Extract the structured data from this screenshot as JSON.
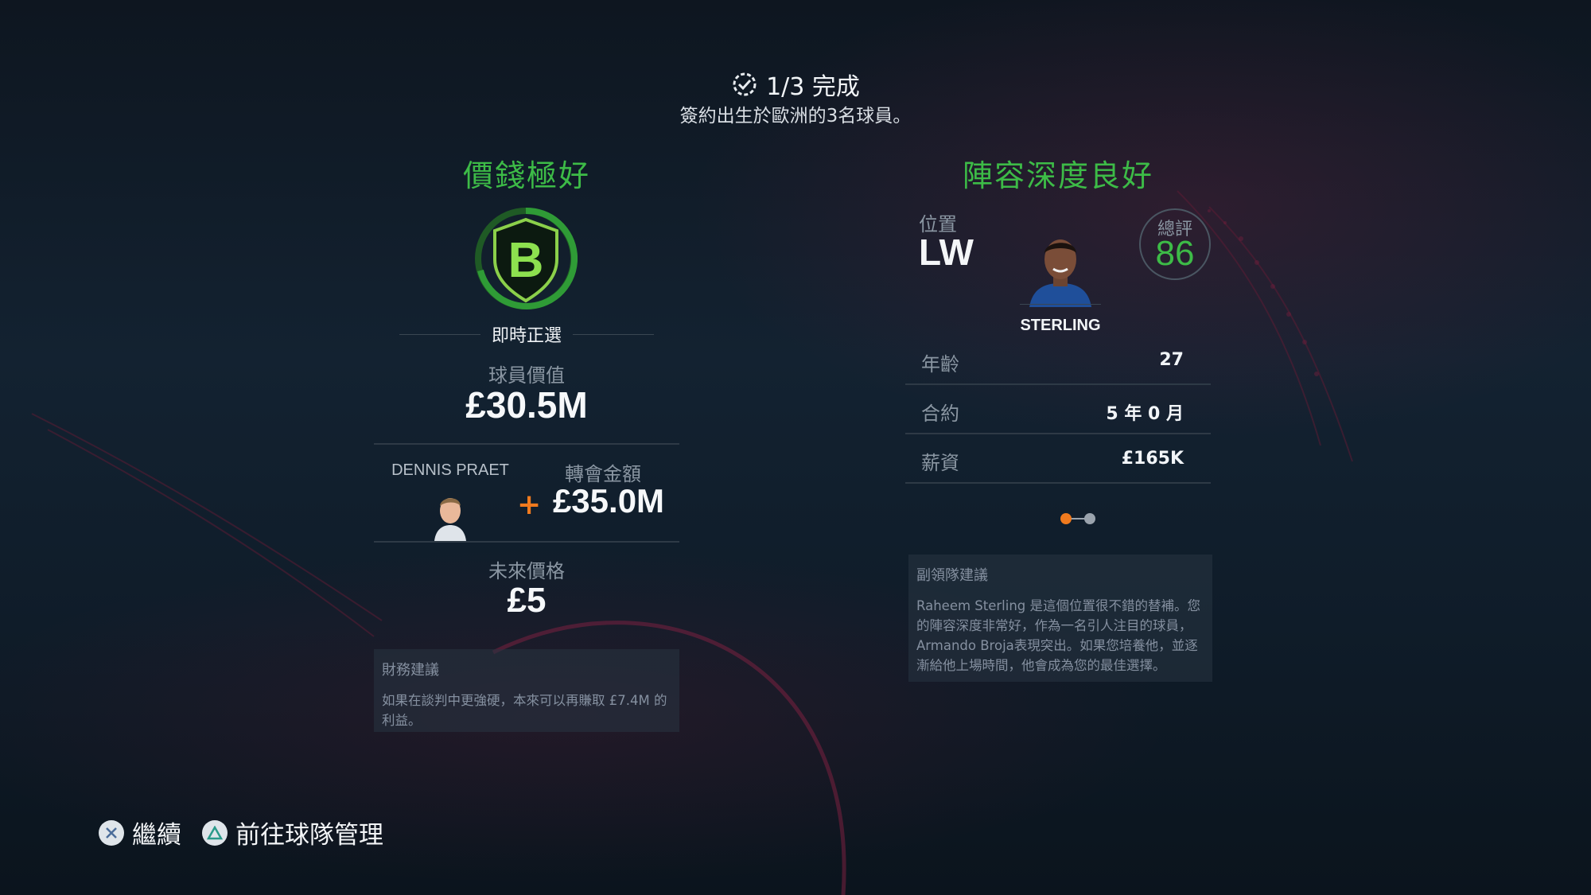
{
  "header": {
    "progress": "1/3 完成",
    "objective": "簽約出生於歐洲的3名球員。"
  },
  "left_panel": {
    "title": "價錢極好",
    "grade": "B",
    "grade_caption": "即時正選",
    "player_value_label": "球員價值",
    "player_value": "£30.5M",
    "swap_player_name": "DENNIS PRAET",
    "plus_sign": "+",
    "transfer_fee_label": "轉會金額",
    "transfer_fee": "£35.0M",
    "future_price_label": "未來價格",
    "future_price": "£5",
    "advice_title": "財務建議",
    "advice_text": "如果在談判中更強硬，本來可以再賺取 £7.4M 的利益。"
  },
  "right_panel": {
    "title": "陣容深度良好",
    "position_label": "位置",
    "position": "LW",
    "rating_label": "總評",
    "rating": "86",
    "player_name": "STERLING",
    "stats": [
      {
        "label": "年齡",
        "value": "27"
      },
      {
        "label": "合約",
        "value": "5 年 0 月"
      },
      {
        "label": "薪資",
        "value": "£165K"
      }
    ],
    "page_indicator": {
      "current": 1,
      "total": 2
    },
    "advice_title": "副領隊建議",
    "advice_text": "Raheem Sterling 是這個位置很不錯的替補。您的陣容深度非常好，作為一名引人注目的球員，Armando Broja表現突出。如果您培養他，並逐漸給他上場時間，他會成為您的最佳選擇。"
  },
  "footer": {
    "continue_label": "繼續",
    "squad_label": "前往球隊管理"
  },
  "colors": {
    "accent_green": "#3dbb47",
    "plus_orange": "#f07a1e",
    "dot_active": "#f07a1e",
    "dot_inactive": "#9aa3ad"
  }
}
